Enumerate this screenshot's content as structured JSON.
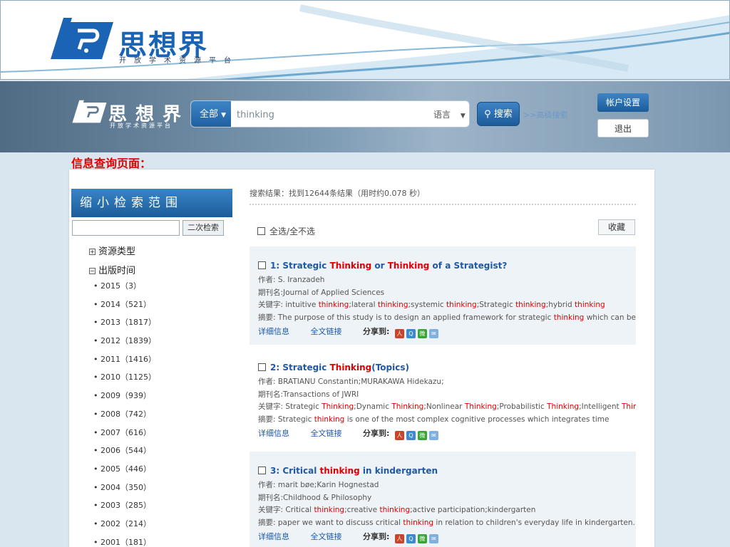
{
  "banner": {
    "name": "思想界",
    "subtitle": "开放学术资源平台"
  },
  "header": {
    "name": "思想界",
    "subtitle": "开放学术资源平台",
    "scope": "全部",
    "search_value": "thinking",
    "language": "语言",
    "search_button": "搜索",
    "advanced_link": ">>高级搜索",
    "account_button": "帐户设置",
    "logout_button": "退出"
  },
  "caption": "信息查询页面：",
  "sidebar": {
    "title": "缩小检索范围",
    "second_search": "二次检索",
    "facets": [
      {
        "label": "资源类型",
        "expanded": false
      },
      {
        "label": "出版时间",
        "expanded": true
      }
    ],
    "years": [
      "2015（3）",
      "2014（521）",
      "2013（1817）",
      "2012（1839）",
      "2011（1416）",
      "2010（1125）",
      "2009（939）",
      "2008（742）",
      "2007（616）",
      "2006（544）",
      "2005（446）",
      "2004（350）",
      "2003（285）",
      "2002（214）",
      "2001（181）"
    ]
  },
  "results": {
    "summary": "搜索结果：找到12644条结果（用时约0.078 秒）",
    "select_all": "全选/全不选",
    "collect": "收藏",
    "detail_label": "详细信息",
    "fulltext_label": "全文链接",
    "share_label": "分享到:",
    "items": [
      {
        "title": [
          {
            "t": "1: Strategic "
          },
          {
            "t": "Thinking",
            "h": true
          },
          {
            "t": " or "
          },
          {
            "t": "Thinking",
            "h": true
          },
          {
            "t": " of a Strategist?"
          }
        ],
        "author": "作者: S. Iranzadeh",
        "journal": "期刊名:Journal of Applied Sciences",
        "keywords": [
          {
            "t": "关键字: intuitive "
          },
          {
            "t": "thinking",
            "h": true
          },
          {
            "t": ";lateral "
          },
          {
            "t": "thinking",
            "h": true
          },
          {
            "t": ";systemic "
          },
          {
            "t": "thinking",
            "h": true
          },
          {
            "t": ";Strategic "
          },
          {
            "t": "thinking",
            "h": true
          },
          {
            "t": ";hybrid "
          },
          {
            "t": "thinking",
            "h": true
          }
        ],
        "abstract": [
          {
            "t": "摘要: The purpose of this study is to design an applied framework for strategic "
          },
          {
            "t": "thinking",
            "h": true
          },
          {
            "t": " which can be"
          }
        ]
      },
      {
        "title": [
          {
            "t": "2: Strategic "
          },
          {
            "t": "Thinking",
            "h": true
          },
          {
            "t": "(Topics)"
          }
        ],
        "author": "作者: BRATIANU Constantin;MURAKAWA Hidekazu;",
        "journal": "期刊名:Transactions of JWRI",
        "keywords": [
          {
            "t": "关键字: Strategic "
          },
          {
            "t": "Thinking",
            "h": true
          },
          {
            "t": ";Dynamic "
          },
          {
            "t": "Thinking",
            "h": true
          },
          {
            "t": ";Nonlinear "
          },
          {
            "t": "Thinking",
            "h": true
          },
          {
            "t": ";Probabilistic "
          },
          {
            "t": "Thinking",
            "h": true
          },
          {
            "t": ";Intelligent "
          },
          {
            "t": "Thinking",
            "h": true
          }
        ],
        "abstract": [
          {
            "t": "摘要: Strategic "
          },
          {
            "t": "thinking",
            "h": true
          },
          {
            "t": " is one of the most complex cognitive processes which integrates time"
          }
        ]
      },
      {
        "title": [
          {
            "t": "3: Critical "
          },
          {
            "t": "thinking",
            "h": true
          },
          {
            "t": " in kindergarten"
          }
        ],
        "author": "作者: marit bøe;Karin Hognestad",
        "journal": "期刊名:Childhood & Philosophy",
        "keywords": [
          {
            "t": "关键字: Critical "
          },
          {
            "t": "thinking",
            "h": true
          },
          {
            "t": ";creative "
          },
          {
            "t": "thinking",
            "h": true
          },
          {
            "t": ";active participation;kindergarten"
          }
        ],
        "abstract": [
          {
            "t": "摘要: paper we want to discuss critical "
          },
          {
            "t": "thinking",
            "h": true
          },
          {
            "t": " in relation to children's everyday life in kindergarten. We"
          }
        ]
      }
    ]
  },
  "colors": {
    "accent": "#1d5fa0",
    "highlight": "#e00000",
    "card_bg": "#eef3f7",
    "header_bg": "#7f9cb5"
  },
  "share_icons": [
    "renren-icon",
    "qzone-icon",
    "wechat-icon",
    "email-icon"
  ]
}
